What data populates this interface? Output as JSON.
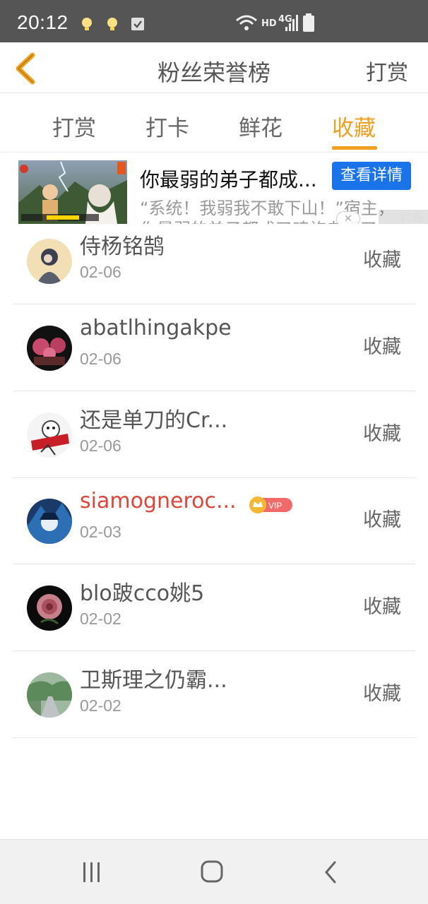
{
  "status_bar": {
    "time": "20:12",
    "network_label": "HD",
    "network_type": "4G",
    "left_icons": [
      "bulb-icon",
      "bulb-icon",
      "checkbox-icon"
    ],
    "right_icons": [
      "wifi-icon",
      "signal-icon",
      "battery-icon"
    ]
  },
  "header": {
    "title": "粉丝荣誉榜",
    "action": "打赏",
    "back_icon": "chevron-left-icon",
    "accent_color": "#f0a020"
  },
  "tabs": [
    {
      "label": "打赏",
      "active": false
    },
    {
      "label": "打卡",
      "active": false
    },
    {
      "label": "鲜花",
      "active": false
    },
    {
      "label": "收藏",
      "active": true
    }
  ],
  "ad": {
    "title": "你最弱的弟子都成...",
    "button": "查看详情",
    "desc": "“系统！我弱我不敢下山！”宿主，",
    "desc2": "你最弱的弟子都成了魂族老祖了",
    "tag": "广告",
    "close": "✕"
  },
  "list": [
    {
      "name": "侍杨铭鹄",
      "date": "02-06",
      "action": "收藏",
      "vip": false
    },
    {
      "name": "abatlhingakpe",
      "date": "02-06",
      "action": "收藏",
      "vip": false
    },
    {
      "name": "还是单刀的Cr...",
      "date": "02-06",
      "action": "收藏",
      "vip": false
    },
    {
      "name": "siamogneroc...",
      "date": "02-03",
      "action": "收藏",
      "vip": true,
      "vip_label": "VIP"
    },
    {
      "name": "blo跛cco姚5",
      "date": "02-02",
      "action": "收藏",
      "vip": false
    },
    {
      "name": "卫斯理之仍霸...",
      "date": "02-02",
      "action": "收藏",
      "vip": false
    }
  ],
  "navbar": {
    "icons": [
      "recent-apps-icon",
      "home-icon",
      "back-icon"
    ]
  }
}
